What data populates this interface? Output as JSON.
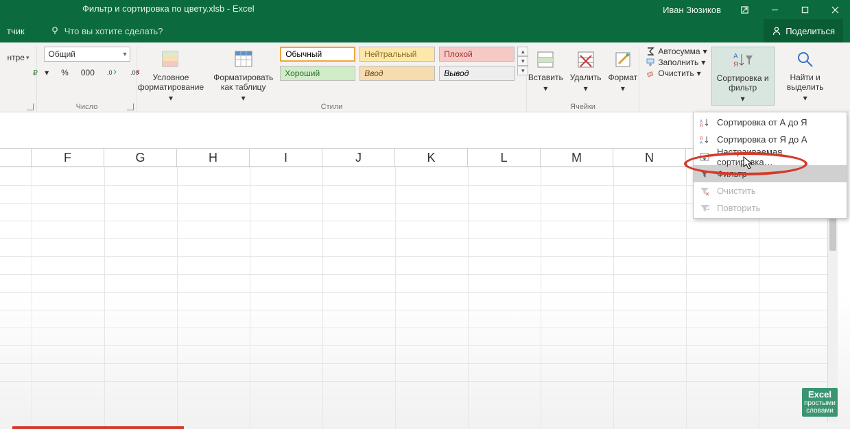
{
  "title": {
    "filename": "Фильтр и сортировка по цвету.xlsb",
    "app": "Excel",
    "user": "Иван Зюзиков"
  },
  "subbar": {
    "tab": "тчик",
    "tellme": "Что вы хотите сделать?",
    "share": "Поделиться"
  },
  "ribbon": {
    "alignment": {
      "centerbtn": "нтре",
      "group": ""
    },
    "number": {
      "format": "Общий",
      "group": "Число",
      "percent": "%",
      "thousands": "000"
    },
    "styles": {
      "cond": "Условное форматирование",
      "table": "Форматировать как таблицу",
      "s1": "Обычный",
      "s2": "Нейтральный",
      "s3": "Плохой",
      "s4": "Хороший",
      "s5": "Ввод",
      "s6": "Вывод",
      "group": "Стили"
    },
    "cells": {
      "insert": "Вставить",
      "delete": "Удалить",
      "format": "Формат",
      "group": "Ячейки"
    },
    "editing": {
      "sum": "Автосумма",
      "fill": "Заполнить",
      "clear": "Очистить",
      "sort": "Сортировка и фильтр",
      "find": "Найти и выделить"
    }
  },
  "dropdown": {
    "az": "Сортировка от А до Я",
    "za": "Сортировка от Я до А",
    "custom": "Настраиваемая сортировка…",
    "filter": "Фильтр",
    "clear": "Очистить",
    "reapply": "Повторить"
  },
  "columns": [
    "F",
    "G",
    "H",
    "I",
    "J",
    "K",
    "L",
    "M",
    "N"
  ],
  "watermark": {
    "line1": "Excel",
    "line2": "простыми",
    "line3": "словами"
  }
}
